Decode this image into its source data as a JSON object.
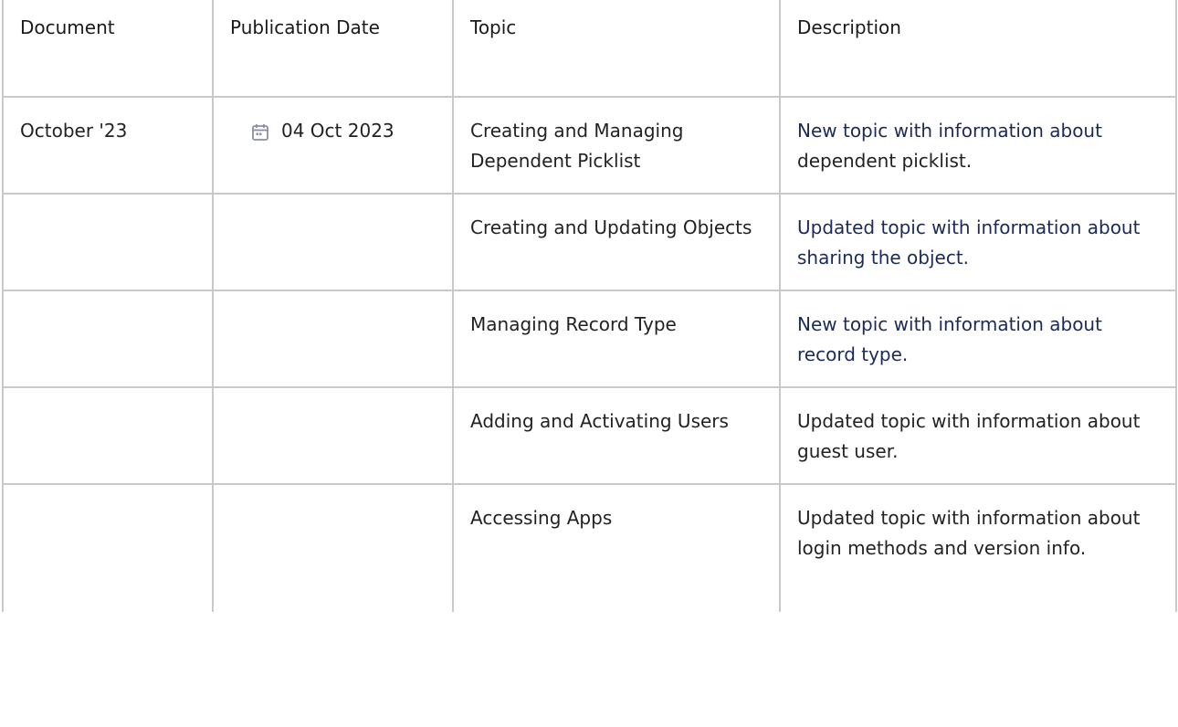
{
  "headers": {
    "document": "Document",
    "publication_date": "Publication Date",
    "topic": "Topic",
    "description": "Description"
  },
  "rows": [
    {
      "document": "October '23",
      "date": "04 Oct 2023",
      "topic": "Creating and Managing Dependent Picklist",
      "description_link": "New topic with information about",
      "description_rest": " dependent picklist."
    },
    {
      "document": "",
      "date": "",
      "topic": "Creating and Updating Objects",
      "description_link": "Updated topic with information about sharing the object.",
      "description_rest": ""
    },
    {
      "document": "",
      "date": "",
      "topic": "Managing Record Type",
      "description_link": "New topic with information about record type.",
      "description_rest": ""
    },
    {
      "document": "",
      "date": "",
      "topic": "Adding and Activating Users",
      "description_link": "",
      "description_rest": "Updated topic with information about guest user."
    },
    {
      "document": "",
      "date": "",
      "topic": "Accessing Apps",
      "description_link": "",
      "description_rest": "Updated topic with information about login methods and version info."
    }
  ],
  "icons": {
    "date": "calendar-icon"
  },
  "colors": {
    "border": "#c9c9c9",
    "link": "#1b2a5a",
    "text": "#222222"
  }
}
